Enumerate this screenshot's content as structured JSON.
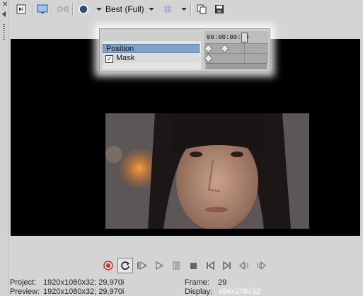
{
  "toolbar": {
    "quality_label": "Best (Full)"
  },
  "popup": {
    "timecode": "00:00:00:00",
    "tracks": [
      {
        "label": "Position"
      },
      {
        "label": "Mask",
        "checked": true
      }
    ]
  },
  "status": {
    "project_label": "Project:",
    "project_value": "1920x1080x32; 29,970i",
    "preview_label": "Preview:",
    "preview_value": "1920x1080x32; 29,970i",
    "frame_label": "Frame:",
    "frame_value": "29",
    "display_label": "Display:",
    "display_value": "494x278x32"
  },
  "icons": {
    "close": "close-icon",
    "record": "record-icon",
    "loop": "loop-icon"
  },
  "colors": {
    "selected_track": "#7fa3c9",
    "playhead": "#e0782a",
    "record": "#c0392b"
  }
}
